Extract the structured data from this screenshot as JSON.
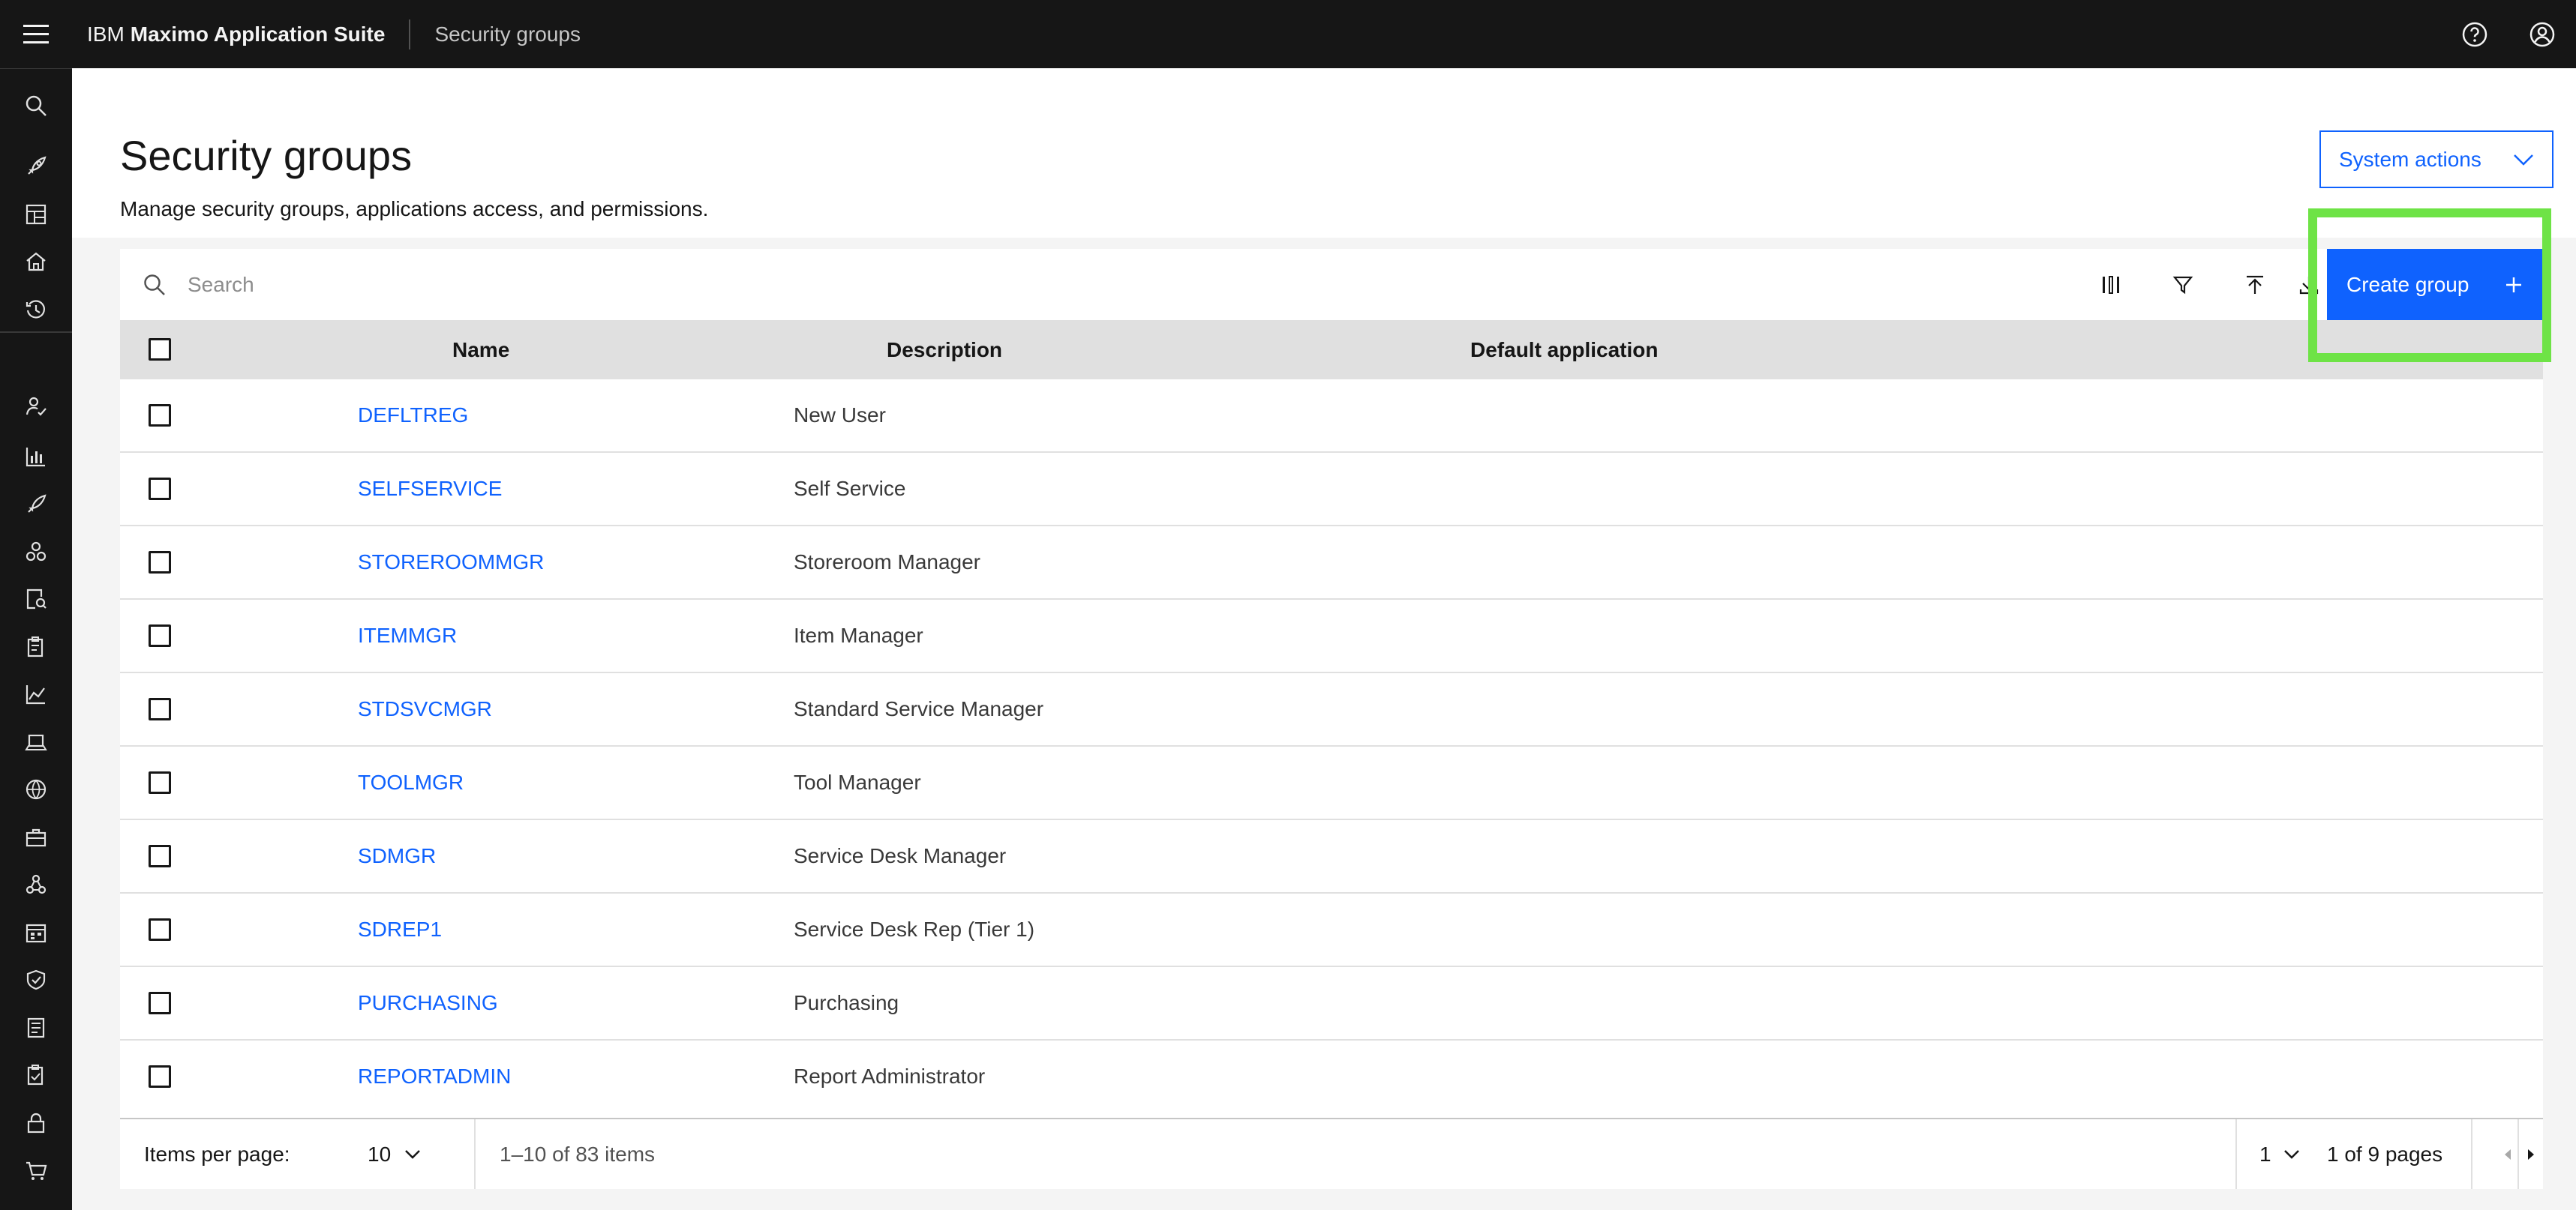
{
  "header": {
    "brand_prefix": "IBM",
    "brand_name": "Maximo Application Suite",
    "current_page": "Security groups"
  },
  "page": {
    "title": "Security groups",
    "subtitle": "Manage security groups, applications access, and permissions.",
    "system_actions_label": "System actions"
  },
  "toolbar": {
    "search_placeholder": "Search",
    "create_label": "Create group"
  },
  "table": {
    "columns": [
      "Name",
      "Description",
      "Default application"
    ],
    "rows": [
      {
        "name": "DEFLTREG",
        "description": "New User"
      },
      {
        "name": "SELFSERVICE",
        "description": "Self Service"
      },
      {
        "name": "STOREROOMMGR",
        "description": "Storeroom Manager"
      },
      {
        "name": "ITEMMGR",
        "description": "Item Manager"
      },
      {
        "name": "STDSVCMGR",
        "description": "Standard Service Manager"
      },
      {
        "name": "TOOLMGR",
        "description": "Tool Manager"
      },
      {
        "name": "SDMGR",
        "description": "Service Desk Manager"
      },
      {
        "name": "SDREP1",
        "description": "Service Desk Rep (Tier 1)"
      },
      {
        "name": "PURCHASING",
        "description": "Purchasing"
      },
      {
        "name": "REPORTADMIN",
        "description": "Report Administrator"
      }
    ]
  },
  "pagination": {
    "items_per_page_label": "Items per page:",
    "items_per_page": "10",
    "range_text": "1–10 of 83 items",
    "current_page": "1",
    "pages_text": "1 of 9 pages"
  },
  "colors": {
    "accent": "#0f62fe",
    "header_bg": "#161616",
    "highlight": "#6ee346"
  },
  "icons": {
    "header": [
      "menu-icon",
      "help-icon",
      "user-avatar-icon"
    ],
    "sidenav": [
      "search-icon",
      "rocket-icon",
      "dashboard-icon",
      "home-icon",
      "recent-icon",
      "user-admin-icon",
      "bar-chart-icon",
      "asset-icon",
      "nodes-icon",
      "inspection-icon",
      "clipboard-icon",
      "line-chart-icon",
      "laptop-icon",
      "network-icon",
      "briefcase-icon",
      "hierarchy-icon",
      "calendar-icon",
      "shield-icon",
      "report-icon",
      "checklist-icon",
      "lock-icon",
      "cart-icon"
    ]
  }
}
